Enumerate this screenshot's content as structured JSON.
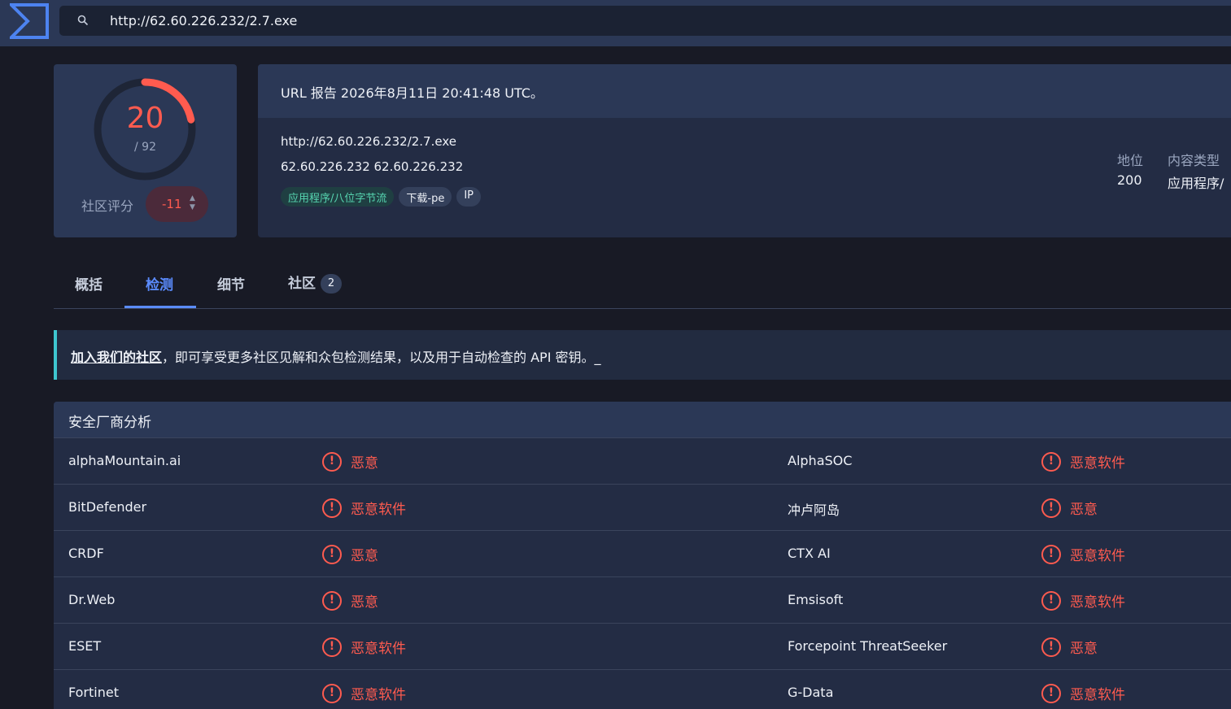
{
  "header": {
    "search_value": "http://62.60.226.232/2.7.exe"
  },
  "score": {
    "detections": "20",
    "total": "/ 92",
    "detection_fraction": 0.2174,
    "community_label": "社区评分",
    "community_value": "-11"
  },
  "report": {
    "title": "URL 报告 2026年8月11日 20:41:48 UTC。",
    "url": "http://62.60.226.232/2.7.exe",
    "ips": "62.60.226.232  62.60.226.232",
    "tags": [
      "应用程序/八位字节流",
      "下载-pe",
      "IP"
    ],
    "meta": {
      "status_label": "地位",
      "status_value": "200",
      "content_type_label": "内容类型",
      "content_type_value": "应用程序/"
    }
  },
  "tabs": [
    {
      "label": "概括"
    },
    {
      "label": "检测"
    },
    {
      "label": "细节"
    },
    {
      "label": "社区",
      "badge": "2"
    }
  ],
  "banner": {
    "link": "加入我们的社区",
    "text": "，即可享受更多社区见解和众包检测结果，以及用于自动检查的 API 密钥。_"
  },
  "vendors": {
    "title": "安全厂商分析",
    "rows": [
      [
        {
          "name": "alphaMountain.ai",
          "result": "恶意"
        },
        {
          "name": "AlphaSOC",
          "result": "恶意软件"
        }
      ],
      [
        {
          "name": "BitDefender",
          "result": "恶意软件"
        },
        {
          "name": "冲卢阿岛",
          "result": "恶意"
        }
      ],
      [
        {
          "name": "CRDF",
          "result": "恶意"
        },
        {
          "name": "CTX AI",
          "result": "恶意软件"
        }
      ],
      [
        {
          "name": "Dr.Web",
          "result": "恶意"
        },
        {
          "name": "Emsisoft",
          "result": "恶意软件"
        }
      ],
      [
        {
          "name": "ESET",
          "result": "恶意软件"
        },
        {
          "name": "Forcepoint ThreatSeeker",
          "result": "恶意"
        }
      ],
      [
        {
          "name": "Fortinet",
          "result": "恶意软件"
        },
        {
          "name": "G-Data",
          "result": "恶意软件"
        }
      ]
    ]
  },
  "colors": {
    "accent": "#5b8cff",
    "danger": "#ff5b4f",
    "teal": "#3ec6cf"
  }
}
